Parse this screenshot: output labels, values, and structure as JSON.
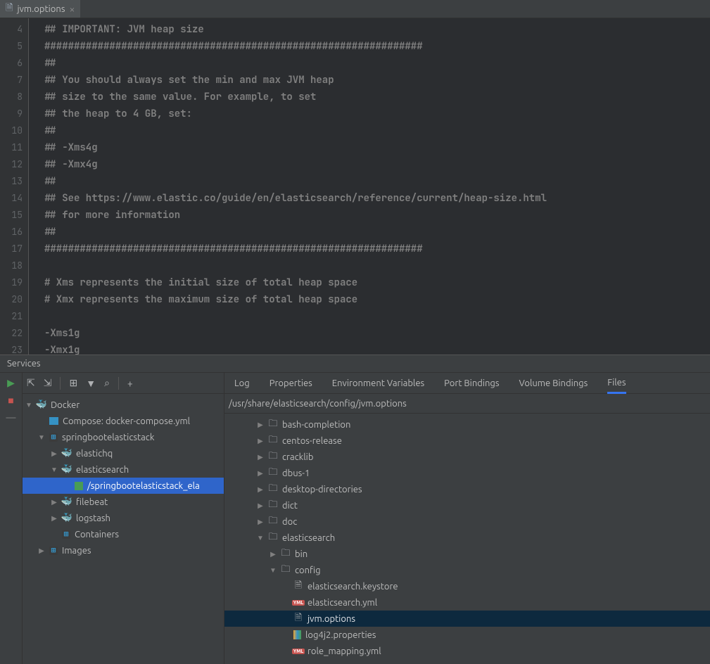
{
  "editor": {
    "tab_title": "jvm.options",
    "first_line_number": 4,
    "lines": [
      "## IMPORTANT: JVM heap size",
      "################################################################",
      "##",
      "## You should always set the min and max JVM heap",
      "## size to the same value. For example, to set",
      "## the heap to 4 GB, set:",
      "##",
      "## -Xms4g",
      "## -Xmx4g",
      "##",
      "## See https://www.elastic.co/guide/en/elasticsearch/reference/current/heap-size.html",
      "## for more information",
      "##",
      "################################################################",
      "",
      "# Xms represents the initial size of total heap space",
      "# Xmx represents the maximum size of total heap space",
      "",
      "-Xms1g",
      "-Xmx1g"
    ]
  },
  "services": {
    "title": "Services",
    "tree": [
      {
        "depth": 0,
        "tw": "▼",
        "ic": "whale",
        "glyph": "🐳",
        "label": "Docker",
        "int": true
      },
      {
        "depth": 1,
        "tw": "",
        "ic": "compose",
        "label": "Compose: docker-compose.yml",
        "int": true
      },
      {
        "depth": 1,
        "tw": "▼",
        "ic": "service",
        "glyph": "⊞",
        "label": "springbootelasticstack",
        "int": true
      },
      {
        "depth": 2,
        "tw": "▶",
        "ic": "proc",
        "glyph": "🐳",
        "label": "elastichq",
        "int": true
      },
      {
        "depth": 2,
        "tw": "▼",
        "ic": "proc",
        "glyph": "🐳",
        "label": "elasticsearch",
        "int": true
      },
      {
        "depth": 3,
        "tw": "",
        "ic": "cont",
        "label": "/springbootelasticstack_ela",
        "int": true,
        "selected": true
      },
      {
        "depth": 2,
        "tw": "▶",
        "ic": "proc",
        "glyph": "🐳",
        "label": "filebeat",
        "int": true
      },
      {
        "depth": 2,
        "tw": "▶",
        "ic": "proc",
        "glyph": "🐳",
        "label": "logstash",
        "int": true
      },
      {
        "depth": 2,
        "tw": "",
        "ic": "service",
        "glyph": "⊞",
        "label": "Containers",
        "int": true
      },
      {
        "depth": 1,
        "tw": "▶",
        "ic": "service",
        "glyph": "⊞",
        "label": "Images",
        "int": true
      }
    ],
    "right_tabs": [
      "Log",
      "Properties",
      "Environment Variables",
      "Port Bindings",
      "Volume Bindings",
      "Files"
    ],
    "active_tab_index": 5,
    "path": "/usr/share/elasticsearch/config/jvm.options",
    "file_tree": [
      {
        "depth": 0,
        "tw": "▶",
        "ic": "fld",
        "label": "bash-completion",
        "int": true
      },
      {
        "depth": 0,
        "tw": "▶",
        "ic": "fld",
        "label": "centos-release",
        "int": true
      },
      {
        "depth": 0,
        "tw": "▶",
        "ic": "fld",
        "label": "cracklib",
        "int": true
      },
      {
        "depth": 0,
        "tw": "▶",
        "ic": "fld",
        "label": "dbus-1",
        "int": true
      },
      {
        "depth": 0,
        "tw": "▶",
        "ic": "fld",
        "label": "desktop-directories",
        "int": true
      },
      {
        "depth": 0,
        "tw": "▶",
        "ic": "fld",
        "label": "dict",
        "int": true
      },
      {
        "depth": 0,
        "tw": "▶",
        "ic": "fld",
        "label": "doc",
        "int": true
      },
      {
        "depth": 0,
        "tw": "▼",
        "ic": "fld",
        "label": "elasticsearch",
        "int": true
      },
      {
        "depth": 1,
        "tw": "▶",
        "ic": "fld",
        "label": "bin",
        "int": true
      },
      {
        "depth": 1,
        "tw": "▼",
        "ic": "fld",
        "label": "config",
        "int": true
      },
      {
        "depth": 2,
        "tw": "",
        "ic": "file",
        "label": "elasticsearch.keystore",
        "int": true
      },
      {
        "depth": 2,
        "tw": "",
        "ic": "yml",
        "label": "elasticsearch.yml",
        "int": true
      },
      {
        "depth": 2,
        "tw": "",
        "ic": "file",
        "label": "jvm.options",
        "int": true,
        "selected2": true
      },
      {
        "depth": 2,
        "tw": "",
        "ic": "prop",
        "label": "log4j2.properties",
        "int": true
      },
      {
        "depth": 2,
        "tw": "",
        "ic": "yml",
        "label": "role_mapping.yml",
        "int": true
      }
    ]
  }
}
